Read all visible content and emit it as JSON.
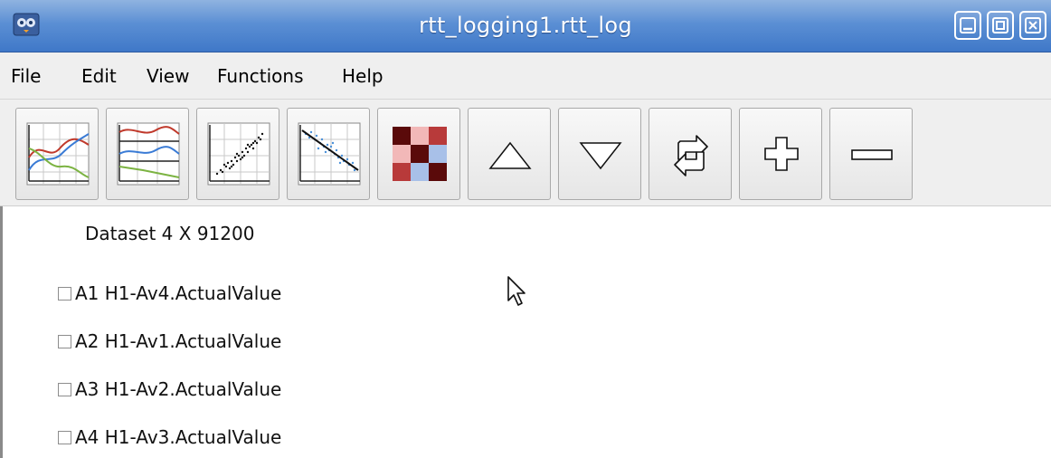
{
  "window": {
    "title": "rtt_logging1.rtt_log",
    "icons": [
      "app-icon",
      "minimize-icon",
      "maximize-icon",
      "close-icon"
    ]
  },
  "menu": {
    "items": [
      "File",
      "Edit",
      "View",
      "Functions",
      "Help"
    ]
  },
  "toolbar": {
    "buttons": [
      {
        "icon": "overlay-line-chart-icon"
      },
      {
        "icon": "stacked-line-charts-icon"
      },
      {
        "icon": "scatter-plot-icon"
      },
      {
        "icon": "regression-scatter-icon"
      },
      {
        "icon": "correlation-matrix-icon"
      },
      {
        "icon": "move-up-icon"
      },
      {
        "icon": "move-down-icon"
      },
      {
        "icon": "refresh-icon"
      },
      {
        "icon": "add-icon"
      },
      {
        "icon": "remove-icon"
      }
    ]
  },
  "content": {
    "dataset_label": "Dataset 4 X 91200",
    "signals": [
      {
        "label": "A1 H1-Av4.ActualValue",
        "checked": false
      },
      {
        "label": "A2 H1-Av1.ActualValue",
        "checked": false
      },
      {
        "label": "A3 H1-Av2.ActualValue",
        "checked": false
      },
      {
        "label": "A4 H1-Av3.ActualValue",
        "checked": false
      }
    ]
  },
  "colors": {
    "titlebar": "#4a82cc",
    "series_red": "#c0392b",
    "series_blue": "#3a7bd5",
    "series_green": "#7cb342"
  }
}
